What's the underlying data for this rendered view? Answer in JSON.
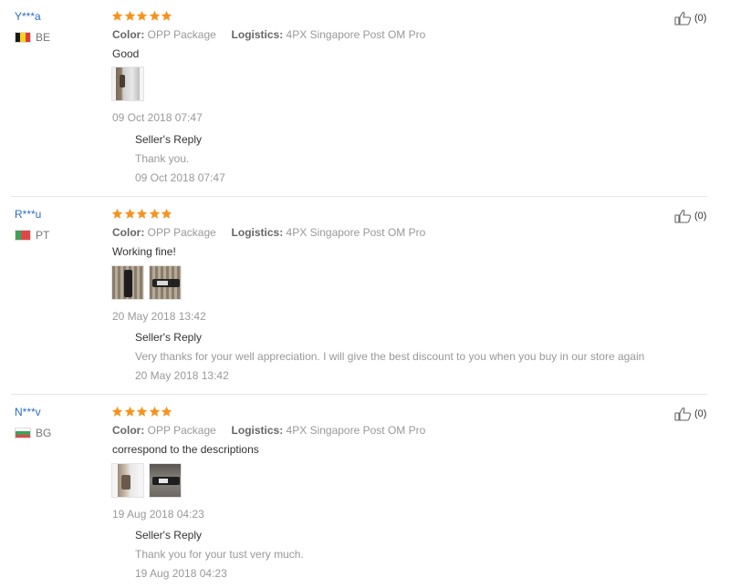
{
  "reviews": [
    {
      "user": "Y***a",
      "country": "BE",
      "rating": 5,
      "color_label": "Color:",
      "color_value": "OPP Package",
      "logistics_label": "Logistics:",
      "logistics_value": "4PX Singapore Post OM Pro",
      "comment": "Good",
      "photos": 1,
      "date": "09 Oct 2018 07:47",
      "reply_title": "Seller's Reply",
      "reply_text": "Thank you.",
      "reply_date": "09 Oct 2018 07:47",
      "helpful": "(0)"
    },
    {
      "user": "R***u",
      "country": "PT",
      "rating": 5,
      "color_label": "Color:",
      "color_value": "OPP Package",
      "logistics_label": "Logistics:",
      "logistics_value": "4PX Singapore Post OM Pro",
      "comment": "Working fine!",
      "photos": 2,
      "date": "20 May 2018 13:42",
      "reply_title": "Seller's Reply",
      "reply_text": "Very thanks for your well appreciation. I will give the best discount to you when you buy in our store again",
      "reply_date": "20 May 2018 13:42",
      "helpful": "(0)"
    },
    {
      "user": "N***v",
      "country": "BG",
      "rating": 5,
      "color_label": "Color:",
      "color_value": "OPP Package",
      "logistics_label": "Logistics:",
      "logistics_value": "4PX Singapore Post OM Pro",
      "comment": "correspond to the descriptions",
      "photos": 2,
      "date": "19 Aug 2018 04:23",
      "reply_title": "Seller's Reply",
      "reply_text": "Thank you for your tust very much.",
      "reply_date": "19 Aug 2018 04:23",
      "helpful": "(0)"
    }
  ],
  "colors": {
    "username": "#2c6cc6",
    "star": "#f7931e",
    "muted": "#999999",
    "separator": "#e6e6e6"
  },
  "icons": {
    "rating": "star-icon",
    "helpful": "thumbs-up-icon"
  }
}
